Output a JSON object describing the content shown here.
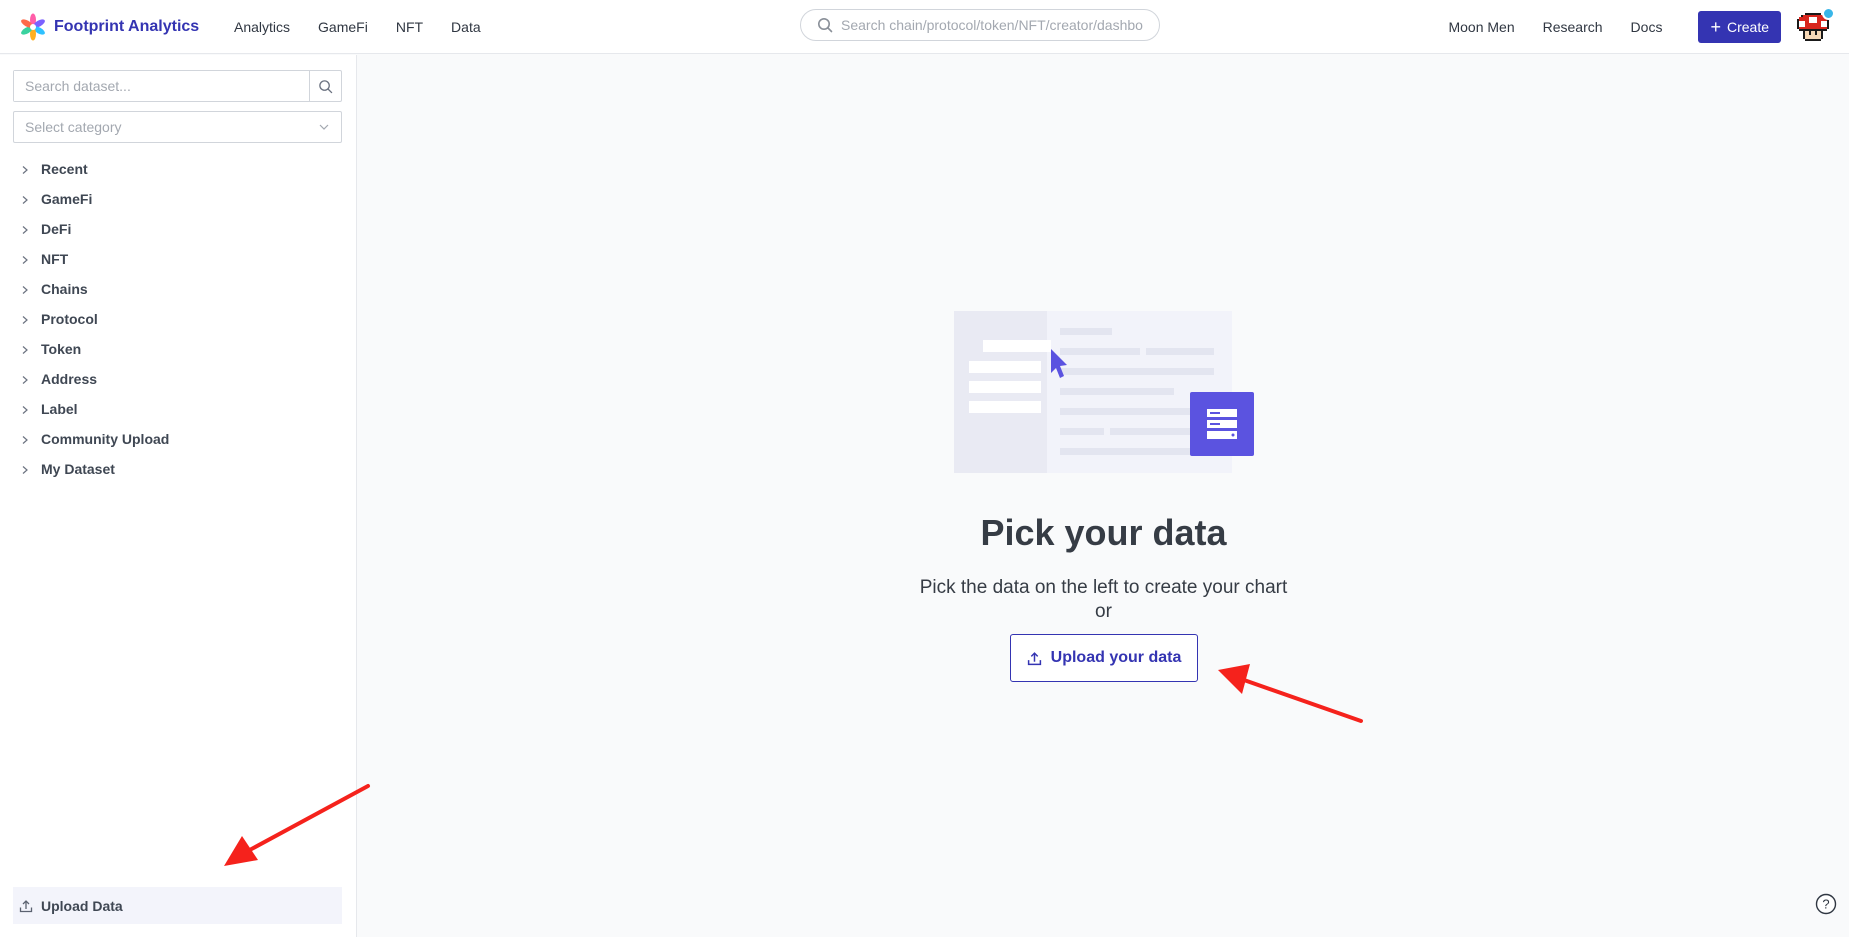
{
  "app": {
    "brand": "Footprint Analytics"
  },
  "nav": {
    "items": [
      "Analytics",
      "GameFi",
      "NFT",
      "Data"
    ]
  },
  "search": {
    "placeholder": "Search chain/protocol/token/NFT/creator/dashbo"
  },
  "right_nav": {
    "links": [
      "Moon Men",
      "Research",
      "Docs"
    ],
    "create_label": "Create"
  },
  "sidebar": {
    "dataset_search_placeholder": "Search dataset...",
    "category_placeholder": "Select category",
    "tree": [
      "Recent",
      "GameFi",
      "DeFi",
      "NFT",
      "Chains",
      "Protocol",
      "Token",
      "Address",
      "Label",
      "Community Upload",
      "My Dataset"
    ],
    "upload_label": "Upload Data"
  },
  "main": {
    "title": "Pick your data",
    "subtitle": "Pick the data on the left to create your chart",
    "or": "or",
    "upload_label": "Upload your data"
  },
  "colors": {
    "brand": "#3434b2",
    "illustration_accent": "#5b53e0",
    "annotation_arrow": "#f5221c"
  }
}
